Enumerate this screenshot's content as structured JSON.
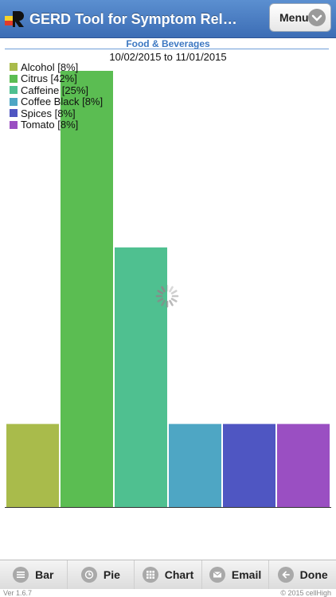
{
  "header": {
    "title": "GERD Tool for Symptom Relief…",
    "menu_label": "Menu"
  },
  "report": {
    "subtitle": "Food & Beverages",
    "date_range": "10/02/2015 to 11/01/2015"
  },
  "chart_data": {
    "type": "bar",
    "categories": [
      "Alcohol [8%]",
      "Citrus [42%]",
      "Caffeine [25%]",
      "Coffee Black [8%]",
      "Spices [8%]",
      "Tomato [8%]"
    ],
    "values": [
      8,
      42,
      25,
      8,
      8,
      8
    ],
    "colors": [
      "#a9bb4b",
      "#5bbd52",
      "#4fc090",
      "#4ea6c4",
      "#4f56c2",
      "#9a4fc2"
    ],
    "ylim": [
      0,
      42
    ],
    "legend_position": "top-left",
    "grid": false
  },
  "footer": {
    "buttons": [
      {
        "label": "Bar",
        "icon": "list-icon"
      },
      {
        "label": "Pie",
        "icon": "clock-icon"
      },
      {
        "label": "Chart",
        "icon": "grid-icon"
      },
      {
        "label": "Email",
        "icon": "email-icon"
      },
      {
        "label": "Done",
        "icon": "back-arrow-icon"
      }
    ],
    "version": "Ver 1.6.7",
    "copyright": "© 2015 cellHigh"
  }
}
